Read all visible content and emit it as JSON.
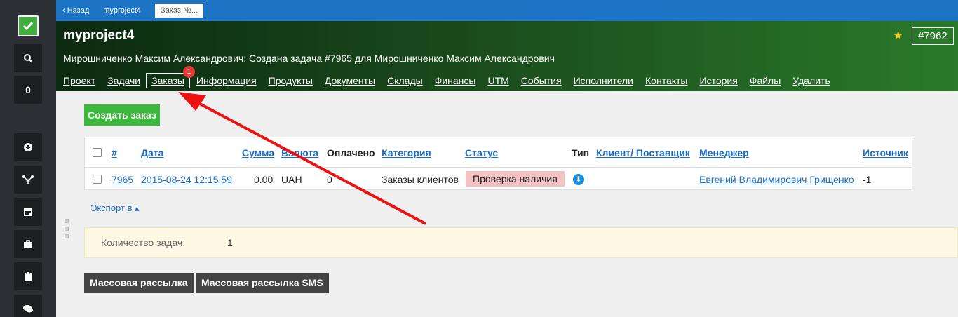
{
  "topbar": {
    "back": "‹ Назад",
    "project": "myproject4",
    "current": "Заказ №..."
  },
  "header": {
    "title": "myproject4",
    "subtitle": "Мирошниченко Максим Александрович: Создана задача #7965 для Мирошниченко Максим Александрович",
    "id": "#7962",
    "nav": [
      "Проект",
      "Задачи",
      "Заказы",
      "Информация",
      "Продукты",
      "Документы",
      "Склады",
      "Финансы",
      "UTM",
      "События",
      "Исполнители",
      "Контакты",
      "История",
      "Файлы",
      "Удалить"
    ],
    "active_badge": "1"
  },
  "sidebar": {
    "counter": "0",
    "icons": [
      "search-icon",
      "plus-icon",
      "sitemap-icon",
      "calendar-icon",
      "briefcase-icon",
      "clipboard-icon",
      "comments-icon"
    ]
  },
  "content": {
    "create_button": "Создать заказ",
    "table": {
      "headers": [
        "#",
        "Дата",
        "Сумма",
        "Валюта",
        "Оплачено",
        "Категория",
        "Статус",
        "Тип",
        "Клиент/ Поставщик",
        "Менеджер",
        "Источник"
      ],
      "row": {
        "id": "7965",
        "date": "2015-08-24 12:15:59",
        "sum": "0.00",
        "currency": "UAH",
        "paid": "0",
        "category": "Заказы клиентов",
        "status": "Проверка наличия",
        "type_icon": "arrow-down-circle-icon",
        "client": "",
        "manager": "Евгений Владимирович Грищенко",
        "source": "-1"
      }
    },
    "export": "Экспорт в ▴",
    "info": {
      "label": "Количество задач:",
      "value": "1"
    },
    "mass_mail": "Массовая рассылка",
    "mass_sms": "Массовая рассылка SMS"
  },
  "colors": {
    "accent_blue": "#1d74c4",
    "link": "#1c6dc9",
    "green_button": "#3cb83c",
    "status_bg": "#f4c2c2",
    "arrow": "#ee1111"
  }
}
